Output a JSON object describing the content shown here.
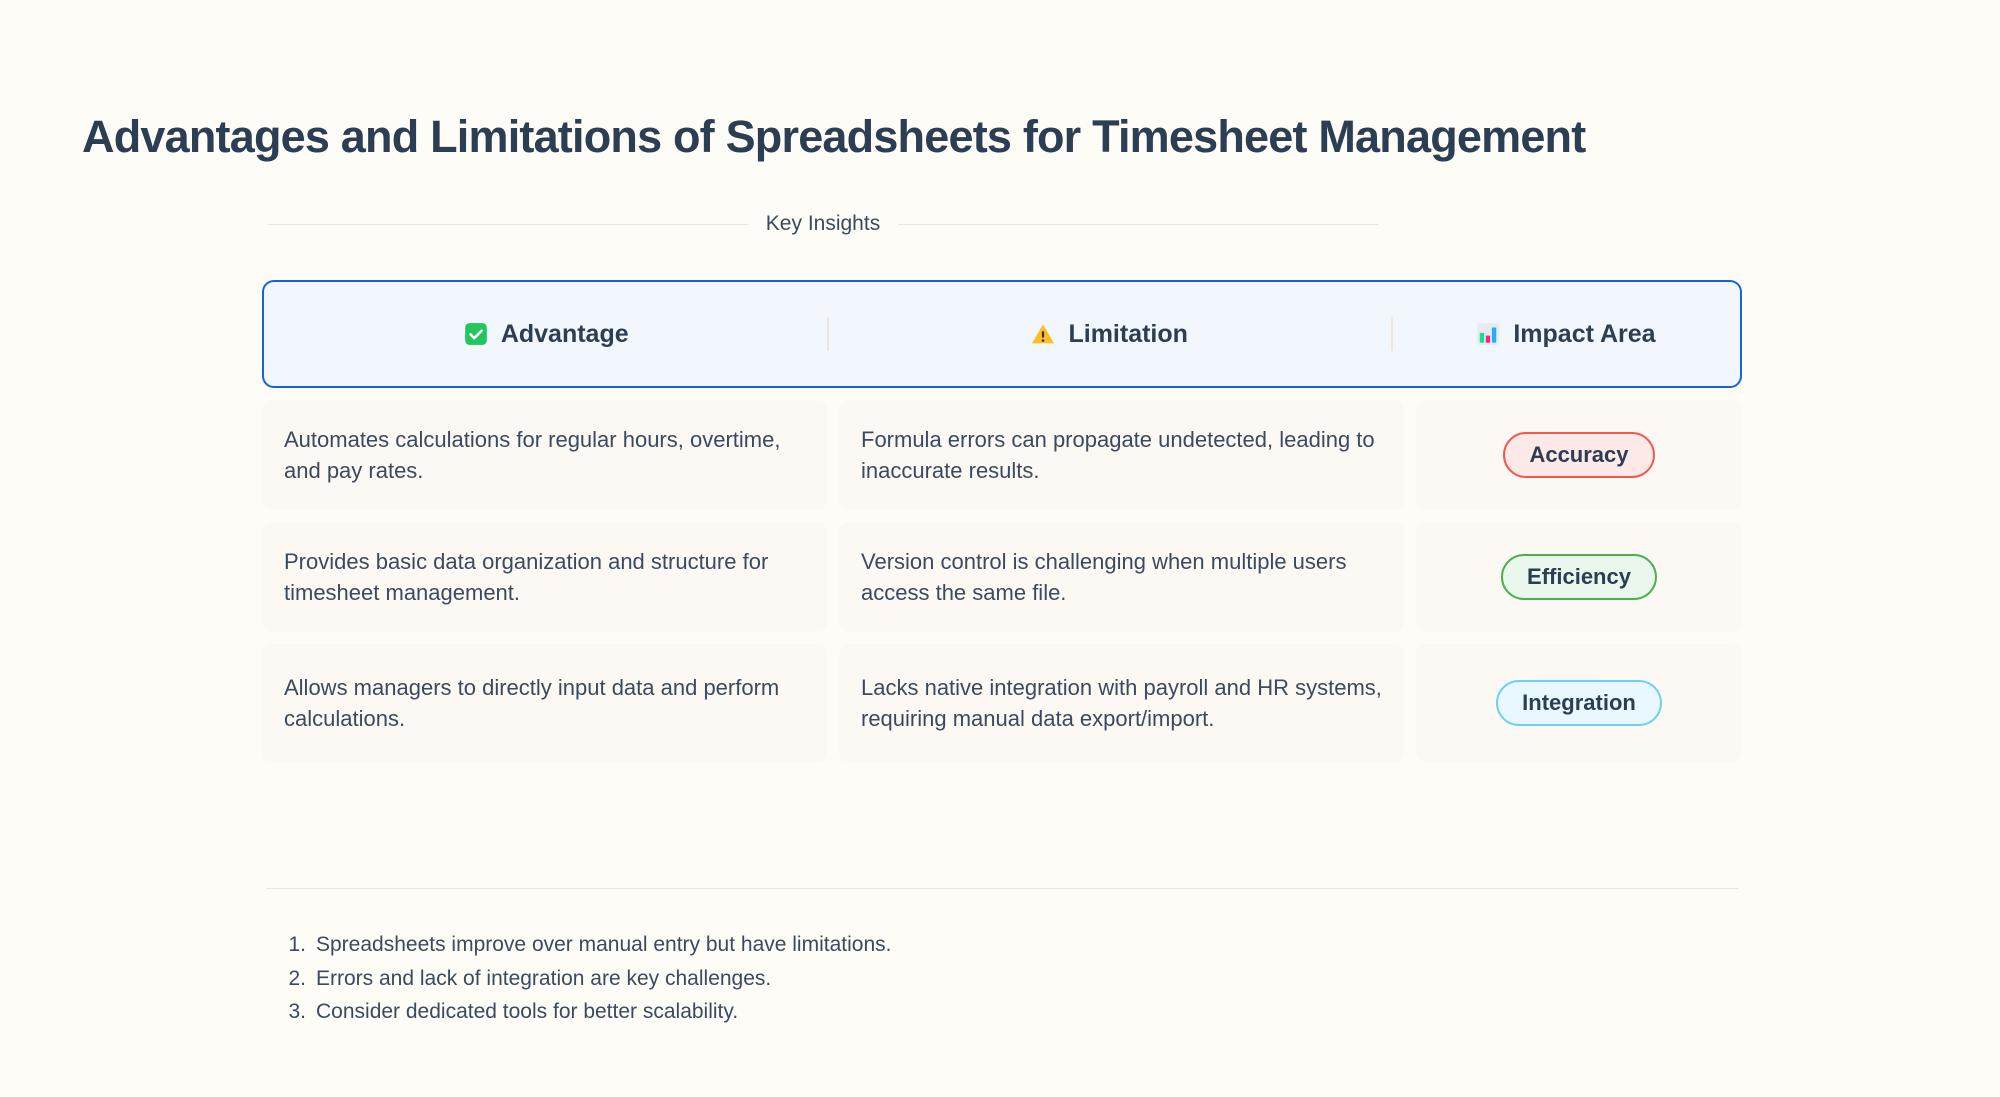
{
  "title": "Advantages and Limitations of Spreadsheets for Timesheet Management",
  "section_label": "Key Insights",
  "table": {
    "headers": [
      {
        "label": "Advantage",
        "icon": "check-square-icon"
      },
      {
        "label": "Limitation",
        "icon": "warning-triangle-icon"
      },
      {
        "label": "Impact Area",
        "icon": "bar-chart-icon"
      }
    ],
    "rows": [
      {
        "advantage": "Automates calculations for regular hours, overtime, and pay rates.",
        "limitation": "Formula errors can propagate undetected, leading to inaccurate results.",
        "impact_area": "Accuracy",
        "impact_style": "accuracy"
      },
      {
        "advantage": "Provides basic data organization and structure for timesheet management.",
        "limitation": "Version control is challenging when multiple users access the same file.",
        "impact_area": "Efficiency",
        "impact_style": "efficiency"
      },
      {
        "advantage": "Allows managers to directly input data and perform calculations.",
        "limitation": "Lacks native integration with payroll and HR systems, requiring manual data export/import.",
        "impact_area": "Integration",
        "impact_style": "integration"
      }
    ]
  },
  "footnotes": [
    {
      "number": "1.",
      "text": "Spreadsheets improve over manual entry but have limitations."
    },
    {
      "number": "2.",
      "text": "Errors and lack of integration are key challenges."
    },
    {
      "number": "3.",
      "text": "Consider dedicated tools for better scalability."
    }
  ],
  "colors": {
    "page_background": "#fdfcf7",
    "title_text": "#2c3e54",
    "header_border": "#1565d8",
    "header_background": "#f2f6fd",
    "cell_background": "#fcf9f4",
    "divider": "#efe6d9",
    "accuracy": "#f4574b",
    "efficiency": "#4caf50",
    "integration": "#6fd0f5"
  }
}
